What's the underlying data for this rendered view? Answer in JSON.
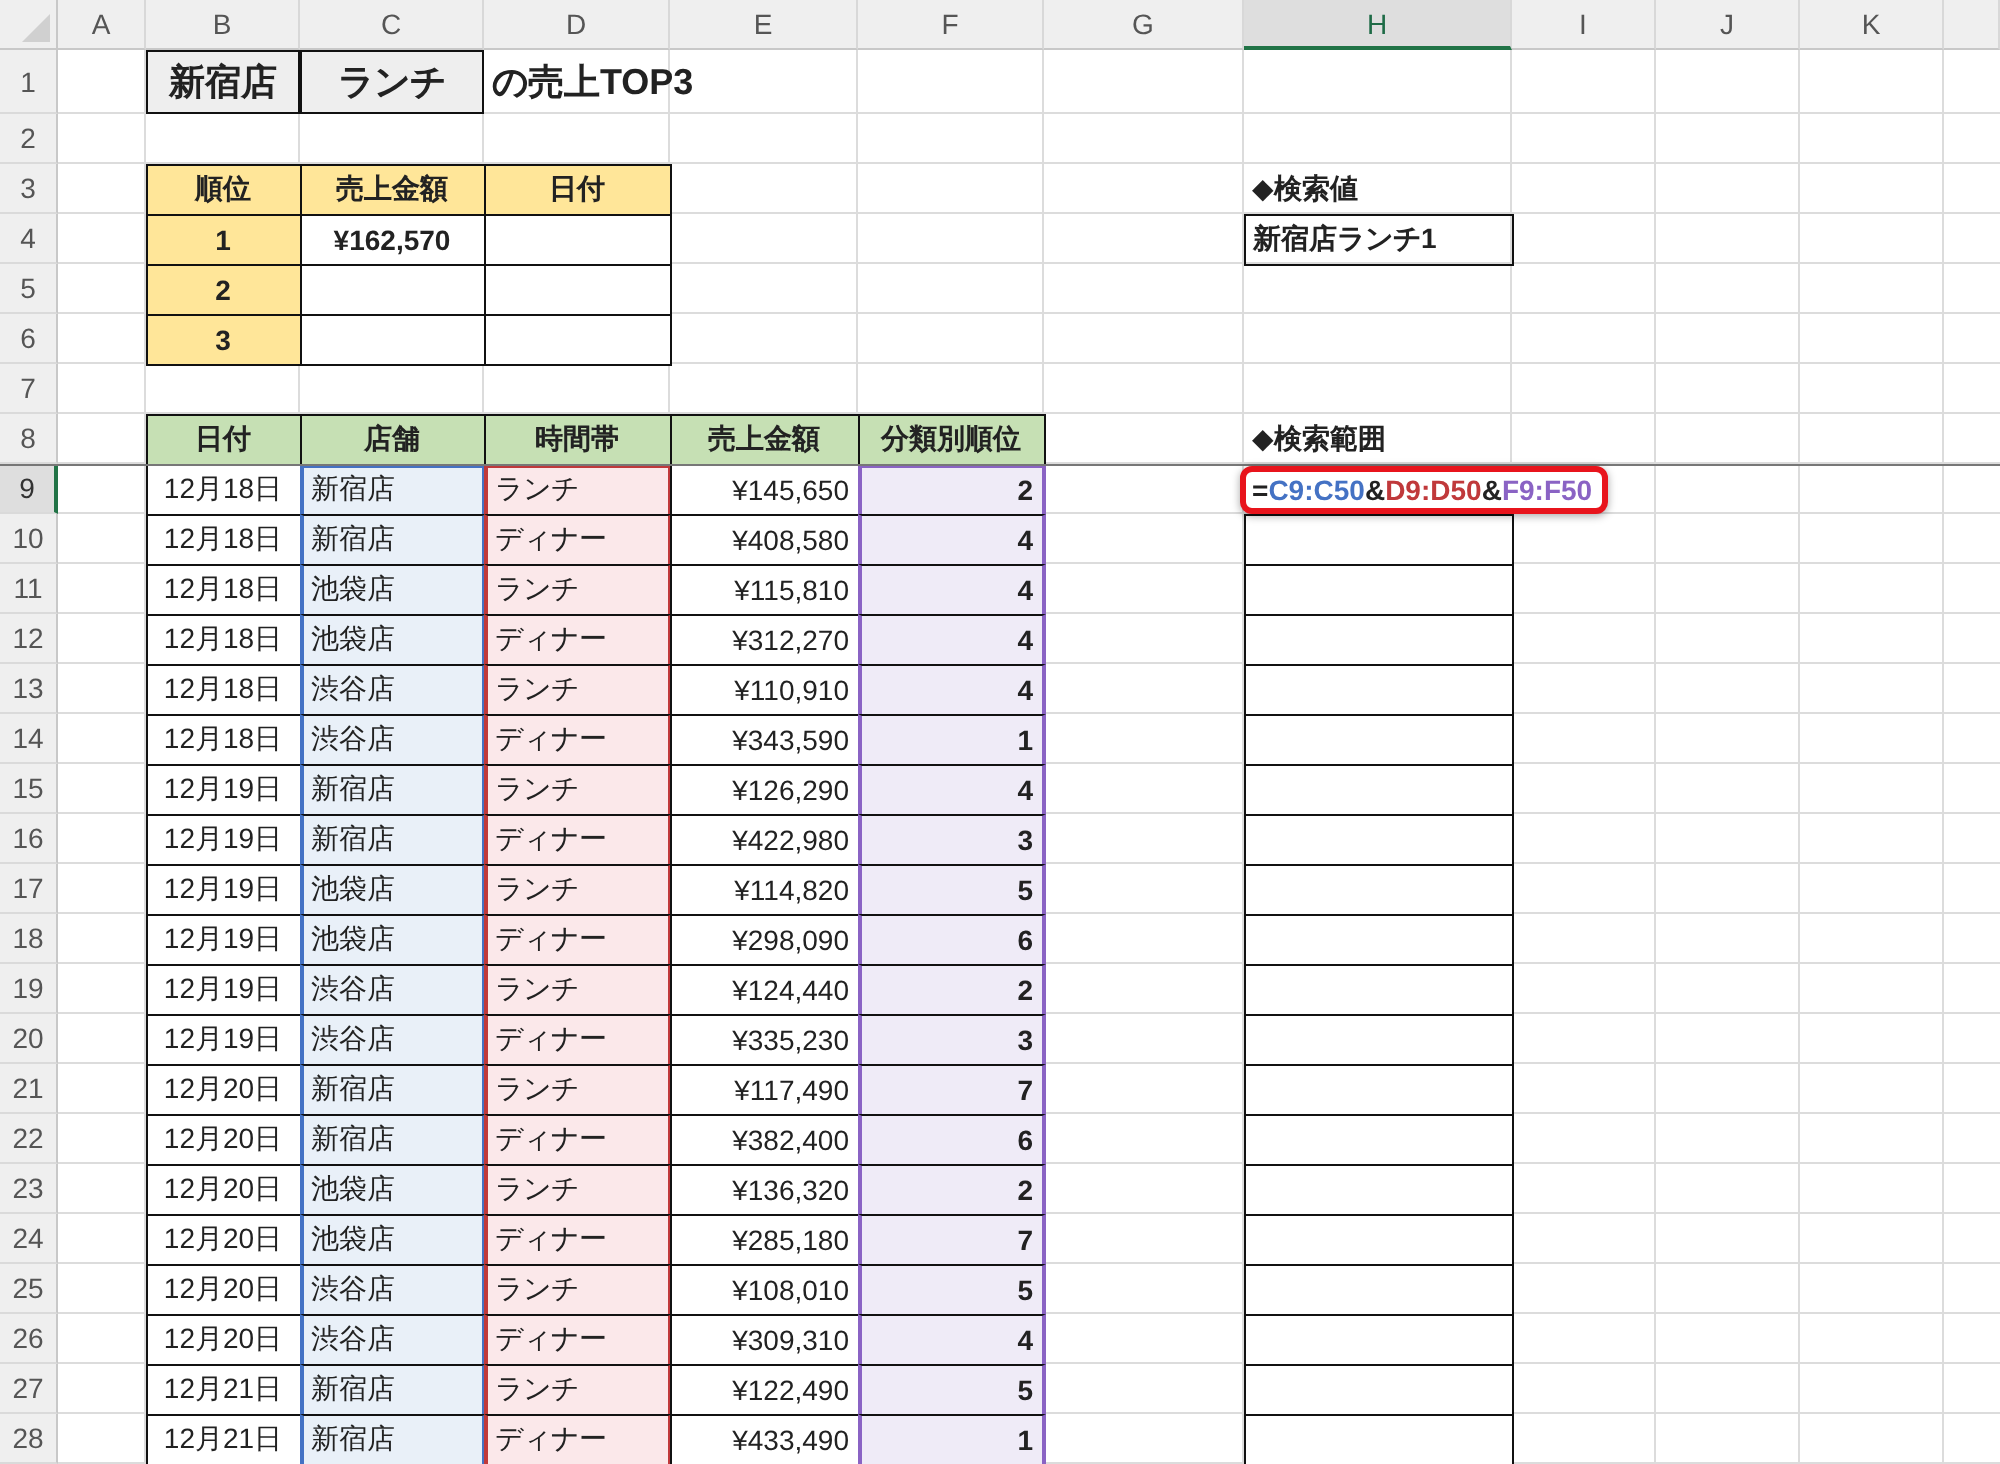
{
  "column_headers": [
    {
      "label": "A",
      "selected": false
    },
    {
      "label": "B",
      "selected": false
    },
    {
      "label": "C",
      "selected": false
    },
    {
      "label": "D",
      "selected": false
    },
    {
      "label": "E",
      "selected": false
    },
    {
      "label": "F",
      "selected": false
    },
    {
      "label": "G",
      "selected": false
    },
    {
      "label": "H",
      "selected": true
    },
    {
      "label": "I",
      "selected": false
    },
    {
      "label": "J",
      "selected": false
    },
    {
      "label": "K",
      "selected": false
    }
  ],
  "row_headers": [
    {
      "label": "1",
      "selected": false
    },
    {
      "label": "2",
      "selected": false
    },
    {
      "label": "3",
      "selected": false
    },
    {
      "label": "4",
      "selected": false
    },
    {
      "label": "5",
      "selected": false
    },
    {
      "label": "6",
      "selected": false
    },
    {
      "label": "7",
      "selected": false
    },
    {
      "label": "8",
      "selected": false
    },
    {
      "label": "9",
      "selected": true
    },
    {
      "label": "10",
      "selected": false
    },
    {
      "label": "11",
      "selected": false
    },
    {
      "label": "12",
      "selected": false
    },
    {
      "label": "13",
      "selected": false
    },
    {
      "label": "14",
      "selected": false
    },
    {
      "label": "15",
      "selected": false
    },
    {
      "label": "16",
      "selected": false
    },
    {
      "label": "17",
      "selected": false
    },
    {
      "label": "18",
      "selected": false
    },
    {
      "label": "19",
      "selected": false
    },
    {
      "label": "20",
      "selected": false
    },
    {
      "label": "21",
      "selected": false
    },
    {
      "label": "22",
      "selected": false
    },
    {
      "label": "23",
      "selected": false
    },
    {
      "label": "24",
      "selected": false
    },
    {
      "label": "25",
      "selected": false
    },
    {
      "label": "26",
      "selected": false
    },
    {
      "label": "27",
      "selected": false
    },
    {
      "label": "28",
      "selected": false
    }
  ],
  "title": {
    "store": "新宿店",
    "time_slot": "ランチ",
    "suffix": "の売上TOP3"
  },
  "top3": {
    "columns": [
      "順位",
      "売上金額",
      "日付"
    ],
    "rows": [
      {
        "rank": "1",
        "amount": "¥162,570"
      },
      {
        "rank": "2"
      },
      {
        "rank": "3"
      }
    ]
  },
  "lookup": {
    "label": "◆検索値",
    "value": "新宿店ランチ1"
  },
  "search_range": {
    "label": "◆検索範囲",
    "formula": [
      {
        "text": "="
      },
      {
        "text": "C9:C50",
        "color": "#4472c4"
      },
      {
        "text": "&"
      },
      {
        "text": "D9:D50",
        "color": "#c0393b"
      },
      {
        "text": "&"
      },
      {
        "text": "F9:F50",
        "color": "#8a63c4"
      }
    ]
  },
  "sales": {
    "columns": [
      "日付",
      "店舗",
      "時間帯",
      "売上金額",
      "分類別順位"
    ],
    "rows": [
      {
        "date": "12月18日",
        "store": "新宿店",
        "time_slot": "ランチ",
        "amount": "¥145,650",
        "rank": "2"
      },
      {
        "date": "12月18日",
        "store": "新宿店",
        "time_slot": "ディナー",
        "amount": "¥408,580",
        "rank": "4"
      },
      {
        "date": "12月18日",
        "store": "池袋店",
        "time_slot": "ランチ",
        "amount": "¥115,810",
        "rank": "4"
      },
      {
        "date": "12月18日",
        "store": "池袋店",
        "time_slot": "ディナー",
        "amount": "¥312,270",
        "rank": "4"
      },
      {
        "date": "12月18日",
        "store": "渋谷店",
        "time_slot": "ランチ",
        "amount": "¥110,910",
        "rank": "4"
      },
      {
        "date": "12月18日",
        "store": "渋谷店",
        "time_slot": "ディナー",
        "amount": "¥343,590",
        "rank": "1"
      },
      {
        "date": "12月19日",
        "store": "新宿店",
        "time_slot": "ランチ",
        "amount": "¥126,290",
        "rank": "4"
      },
      {
        "date": "12月19日",
        "store": "新宿店",
        "time_slot": "ディナー",
        "amount": "¥422,980",
        "rank": "3"
      },
      {
        "date": "12月19日",
        "store": "池袋店",
        "time_slot": "ランチ",
        "amount": "¥114,820",
        "rank": "5"
      },
      {
        "date": "12月19日",
        "store": "池袋店",
        "time_slot": "ディナー",
        "amount": "¥298,090",
        "rank": "6"
      },
      {
        "date": "12月19日",
        "store": "渋谷店",
        "time_slot": "ランチ",
        "amount": "¥124,440",
        "rank": "2"
      },
      {
        "date": "12月19日",
        "store": "渋谷店",
        "time_slot": "ディナー",
        "amount": "¥335,230",
        "rank": "3"
      },
      {
        "date": "12月20日",
        "store": "新宿店",
        "time_slot": "ランチ",
        "amount": "¥117,490",
        "rank": "7"
      },
      {
        "date": "12月20日",
        "store": "新宿店",
        "time_slot": "ディナー",
        "amount": "¥382,400",
        "rank": "6"
      },
      {
        "date": "12月20日",
        "store": "池袋店",
        "time_slot": "ランチ",
        "amount": "¥136,320",
        "rank": "2"
      },
      {
        "date": "12月20日",
        "store": "池袋店",
        "time_slot": "ディナー",
        "amount": "¥285,180",
        "rank": "7"
      },
      {
        "date": "12月20日",
        "store": "渋谷店",
        "time_slot": "ランチ",
        "amount": "¥108,010",
        "rank": "5"
      },
      {
        "date": "12月20日",
        "store": "渋谷店",
        "time_slot": "ディナー",
        "amount": "¥309,310",
        "rank": "4"
      },
      {
        "date": "12月21日",
        "store": "新宿店",
        "time_slot": "ランチ",
        "amount": "¥122,490",
        "rank": "5"
      },
      {
        "date": "12月21日",
        "store": "新宿店",
        "time_slot": "ディナー",
        "amount": "¥433,490",
        "rank": "1"
      }
    ]
  }
}
